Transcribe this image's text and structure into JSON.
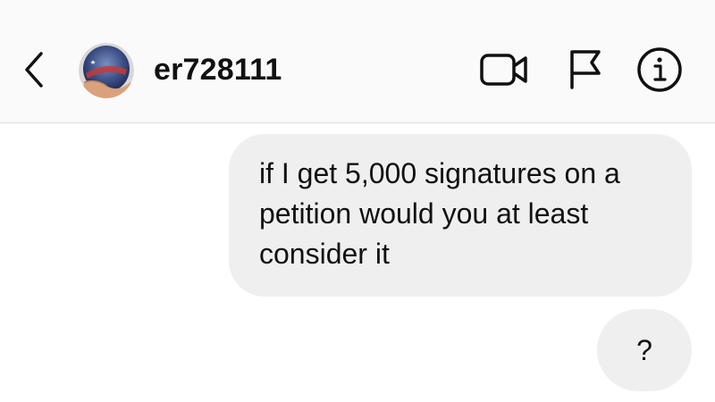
{
  "header": {
    "username": "er728111",
    "icons": {
      "back": "chevron-left-icon",
      "video": "video-camera-icon",
      "flag": "flag-icon",
      "info": "info-icon"
    }
  },
  "messages": [
    {
      "text": "if I get 5,000 signatures on a petition would you at least consider it",
      "sender": "me"
    },
    {
      "text": "?",
      "sender": "me"
    }
  ],
  "colors": {
    "header_bg": "#fafafa",
    "bubble_bg": "#efefef",
    "text": "#111111",
    "divider": "#dcdcdc"
  }
}
